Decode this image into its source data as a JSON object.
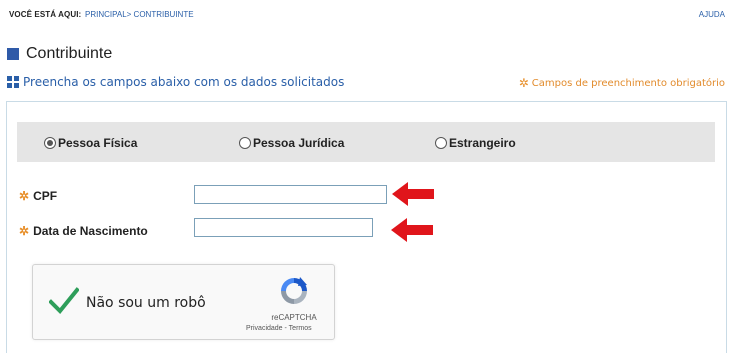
{
  "topbar": {
    "you_are_here": "VOCÊ ESTÁ AQUI:",
    "crumb_home": "PRINCIPAL",
    "crumb_sep": ">",
    "crumb_current": "CONTRIBUINTE",
    "help": "AJUDA"
  },
  "page": {
    "title": "Contribuinte",
    "subtitle": "Preencha os campos abaixo com os dados solicitados",
    "required_note": "Campos de preenchimento obrigatório"
  },
  "person_type": {
    "options": [
      {
        "label": "Pessoa Física",
        "checked": true
      },
      {
        "label": "Pessoa Jurídica",
        "checked": false
      },
      {
        "label": "Estrangeiro",
        "checked": false
      }
    ]
  },
  "fields": {
    "cpf": {
      "label": "CPF",
      "value": ""
    },
    "birth_date": {
      "label": "Data de Nascimento",
      "value": ""
    }
  },
  "captcha": {
    "label": "Não sou um robô",
    "brand": "reCAPTCHA",
    "terms": "Privacidade - Termos"
  },
  "colors": {
    "link_blue": "#2a5fa8",
    "required_orange": "#e8912d",
    "arrow_red": "#e0151b",
    "check_green": "#2e9e5a"
  },
  "icons": {
    "title_square": "square-icon",
    "subtitle_grid": "grid-icon",
    "required": "asterisk-icon",
    "annotation": "red-arrow-icon"
  }
}
